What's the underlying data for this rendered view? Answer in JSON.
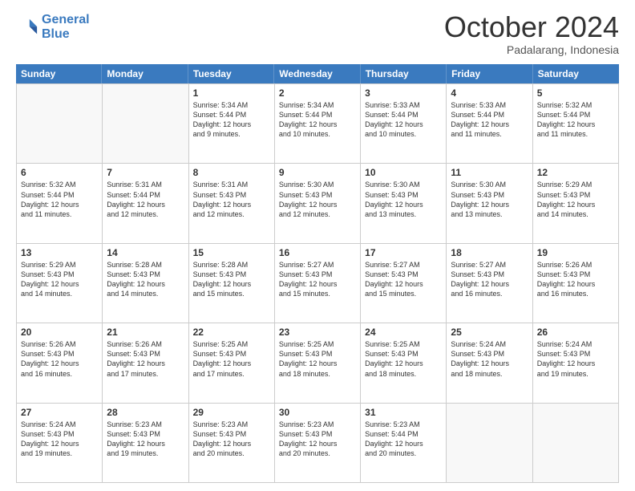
{
  "header": {
    "logo_line1": "General",
    "logo_line2": "Blue",
    "month": "October 2024",
    "location": "Padalarang, Indonesia"
  },
  "days_of_week": [
    "Sunday",
    "Monday",
    "Tuesday",
    "Wednesday",
    "Thursday",
    "Friday",
    "Saturday"
  ],
  "weeks": [
    [
      {
        "day": "",
        "lines": []
      },
      {
        "day": "",
        "lines": []
      },
      {
        "day": "1",
        "lines": [
          "Sunrise: 5:34 AM",
          "Sunset: 5:44 PM",
          "Daylight: 12 hours",
          "and 9 minutes."
        ]
      },
      {
        "day": "2",
        "lines": [
          "Sunrise: 5:34 AM",
          "Sunset: 5:44 PM",
          "Daylight: 12 hours",
          "and 10 minutes."
        ]
      },
      {
        "day": "3",
        "lines": [
          "Sunrise: 5:33 AM",
          "Sunset: 5:44 PM",
          "Daylight: 12 hours",
          "and 10 minutes."
        ]
      },
      {
        "day": "4",
        "lines": [
          "Sunrise: 5:33 AM",
          "Sunset: 5:44 PM",
          "Daylight: 12 hours",
          "and 11 minutes."
        ]
      },
      {
        "day": "5",
        "lines": [
          "Sunrise: 5:32 AM",
          "Sunset: 5:44 PM",
          "Daylight: 12 hours",
          "and 11 minutes."
        ]
      }
    ],
    [
      {
        "day": "6",
        "lines": [
          "Sunrise: 5:32 AM",
          "Sunset: 5:44 PM",
          "Daylight: 12 hours",
          "and 11 minutes."
        ]
      },
      {
        "day": "7",
        "lines": [
          "Sunrise: 5:31 AM",
          "Sunset: 5:44 PM",
          "Daylight: 12 hours",
          "and 12 minutes."
        ]
      },
      {
        "day": "8",
        "lines": [
          "Sunrise: 5:31 AM",
          "Sunset: 5:43 PM",
          "Daylight: 12 hours",
          "and 12 minutes."
        ]
      },
      {
        "day": "9",
        "lines": [
          "Sunrise: 5:30 AM",
          "Sunset: 5:43 PM",
          "Daylight: 12 hours",
          "and 12 minutes."
        ]
      },
      {
        "day": "10",
        "lines": [
          "Sunrise: 5:30 AM",
          "Sunset: 5:43 PM",
          "Daylight: 12 hours",
          "and 13 minutes."
        ]
      },
      {
        "day": "11",
        "lines": [
          "Sunrise: 5:30 AM",
          "Sunset: 5:43 PM",
          "Daylight: 12 hours",
          "and 13 minutes."
        ]
      },
      {
        "day": "12",
        "lines": [
          "Sunrise: 5:29 AM",
          "Sunset: 5:43 PM",
          "Daylight: 12 hours",
          "and 14 minutes."
        ]
      }
    ],
    [
      {
        "day": "13",
        "lines": [
          "Sunrise: 5:29 AM",
          "Sunset: 5:43 PM",
          "Daylight: 12 hours",
          "and 14 minutes."
        ]
      },
      {
        "day": "14",
        "lines": [
          "Sunrise: 5:28 AM",
          "Sunset: 5:43 PM",
          "Daylight: 12 hours",
          "and 14 minutes."
        ]
      },
      {
        "day": "15",
        "lines": [
          "Sunrise: 5:28 AM",
          "Sunset: 5:43 PM",
          "Daylight: 12 hours",
          "and 15 minutes."
        ]
      },
      {
        "day": "16",
        "lines": [
          "Sunrise: 5:27 AM",
          "Sunset: 5:43 PM",
          "Daylight: 12 hours",
          "and 15 minutes."
        ]
      },
      {
        "day": "17",
        "lines": [
          "Sunrise: 5:27 AM",
          "Sunset: 5:43 PM",
          "Daylight: 12 hours",
          "and 15 minutes."
        ]
      },
      {
        "day": "18",
        "lines": [
          "Sunrise: 5:27 AM",
          "Sunset: 5:43 PM",
          "Daylight: 12 hours",
          "and 16 minutes."
        ]
      },
      {
        "day": "19",
        "lines": [
          "Sunrise: 5:26 AM",
          "Sunset: 5:43 PM",
          "Daylight: 12 hours",
          "and 16 minutes."
        ]
      }
    ],
    [
      {
        "day": "20",
        "lines": [
          "Sunrise: 5:26 AM",
          "Sunset: 5:43 PM",
          "Daylight: 12 hours",
          "and 16 minutes."
        ]
      },
      {
        "day": "21",
        "lines": [
          "Sunrise: 5:26 AM",
          "Sunset: 5:43 PM",
          "Daylight: 12 hours",
          "and 17 minutes."
        ]
      },
      {
        "day": "22",
        "lines": [
          "Sunrise: 5:25 AM",
          "Sunset: 5:43 PM",
          "Daylight: 12 hours",
          "and 17 minutes."
        ]
      },
      {
        "day": "23",
        "lines": [
          "Sunrise: 5:25 AM",
          "Sunset: 5:43 PM",
          "Daylight: 12 hours",
          "and 18 minutes."
        ]
      },
      {
        "day": "24",
        "lines": [
          "Sunrise: 5:25 AM",
          "Sunset: 5:43 PM",
          "Daylight: 12 hours",
          "and 18 minutes."
        ]
      },
      {
        "day": "25",
        "lines": [
          "Sunrise: 5:24 AM",
          "Sunset: 5:43 PM",
          "Daylight: 12 hours",
          "and 18 minutes."
        ]
      },
      {
        "day": "26",
        "lines": [
          "Sunrise: 5:24 AM",
          "Sunset: 5:43 PM",
          "Daylight: 12 hours",
          "and 19 minutes."
        ]
      }
    ],
    [
      {
        "day": "27",
        "lines": [
          "Sunrise: 5:24 AM",
          "Sunset: 5:43 PM",
          "Daylight: 12 hours",
          "and 19 minutes."
        ]
      },
      {
        "day": "28",
        "lines": [
          "Sunrise: 5:23 AM",
          "Sunset: 5:43 PM",
          "Daylight: 12 hours",
          "and 19 minutes."
        ]
      },
      {
        "day": "29",
        "lines": [
          "Sunrise: 5:23 AM",
          "Sunset: 5:43 PM",
          "Daylight: 12 hours",
          "and 20 minutes."
        ]
      },
      {
        "day": "30",
        "lines": [
          "Sunrise: 5:23 AM",
          "Sunset: 5:43 PM",
          "Daylight: 12 hours",
          "and 20 minutes."
        ]
      },
      {
        "day": "31",
        "lines": [
          "Sunrise: 5:23 AM",
          "Sunset: 5:44 PM",
          "Daylight: 12 hours",
          "and 20 minutes."
        ]
      },
      {
        "day": "",
        "lines": []
      },
      {
        "day": "",
        "lines": []
      }
    ]
  ]
}
